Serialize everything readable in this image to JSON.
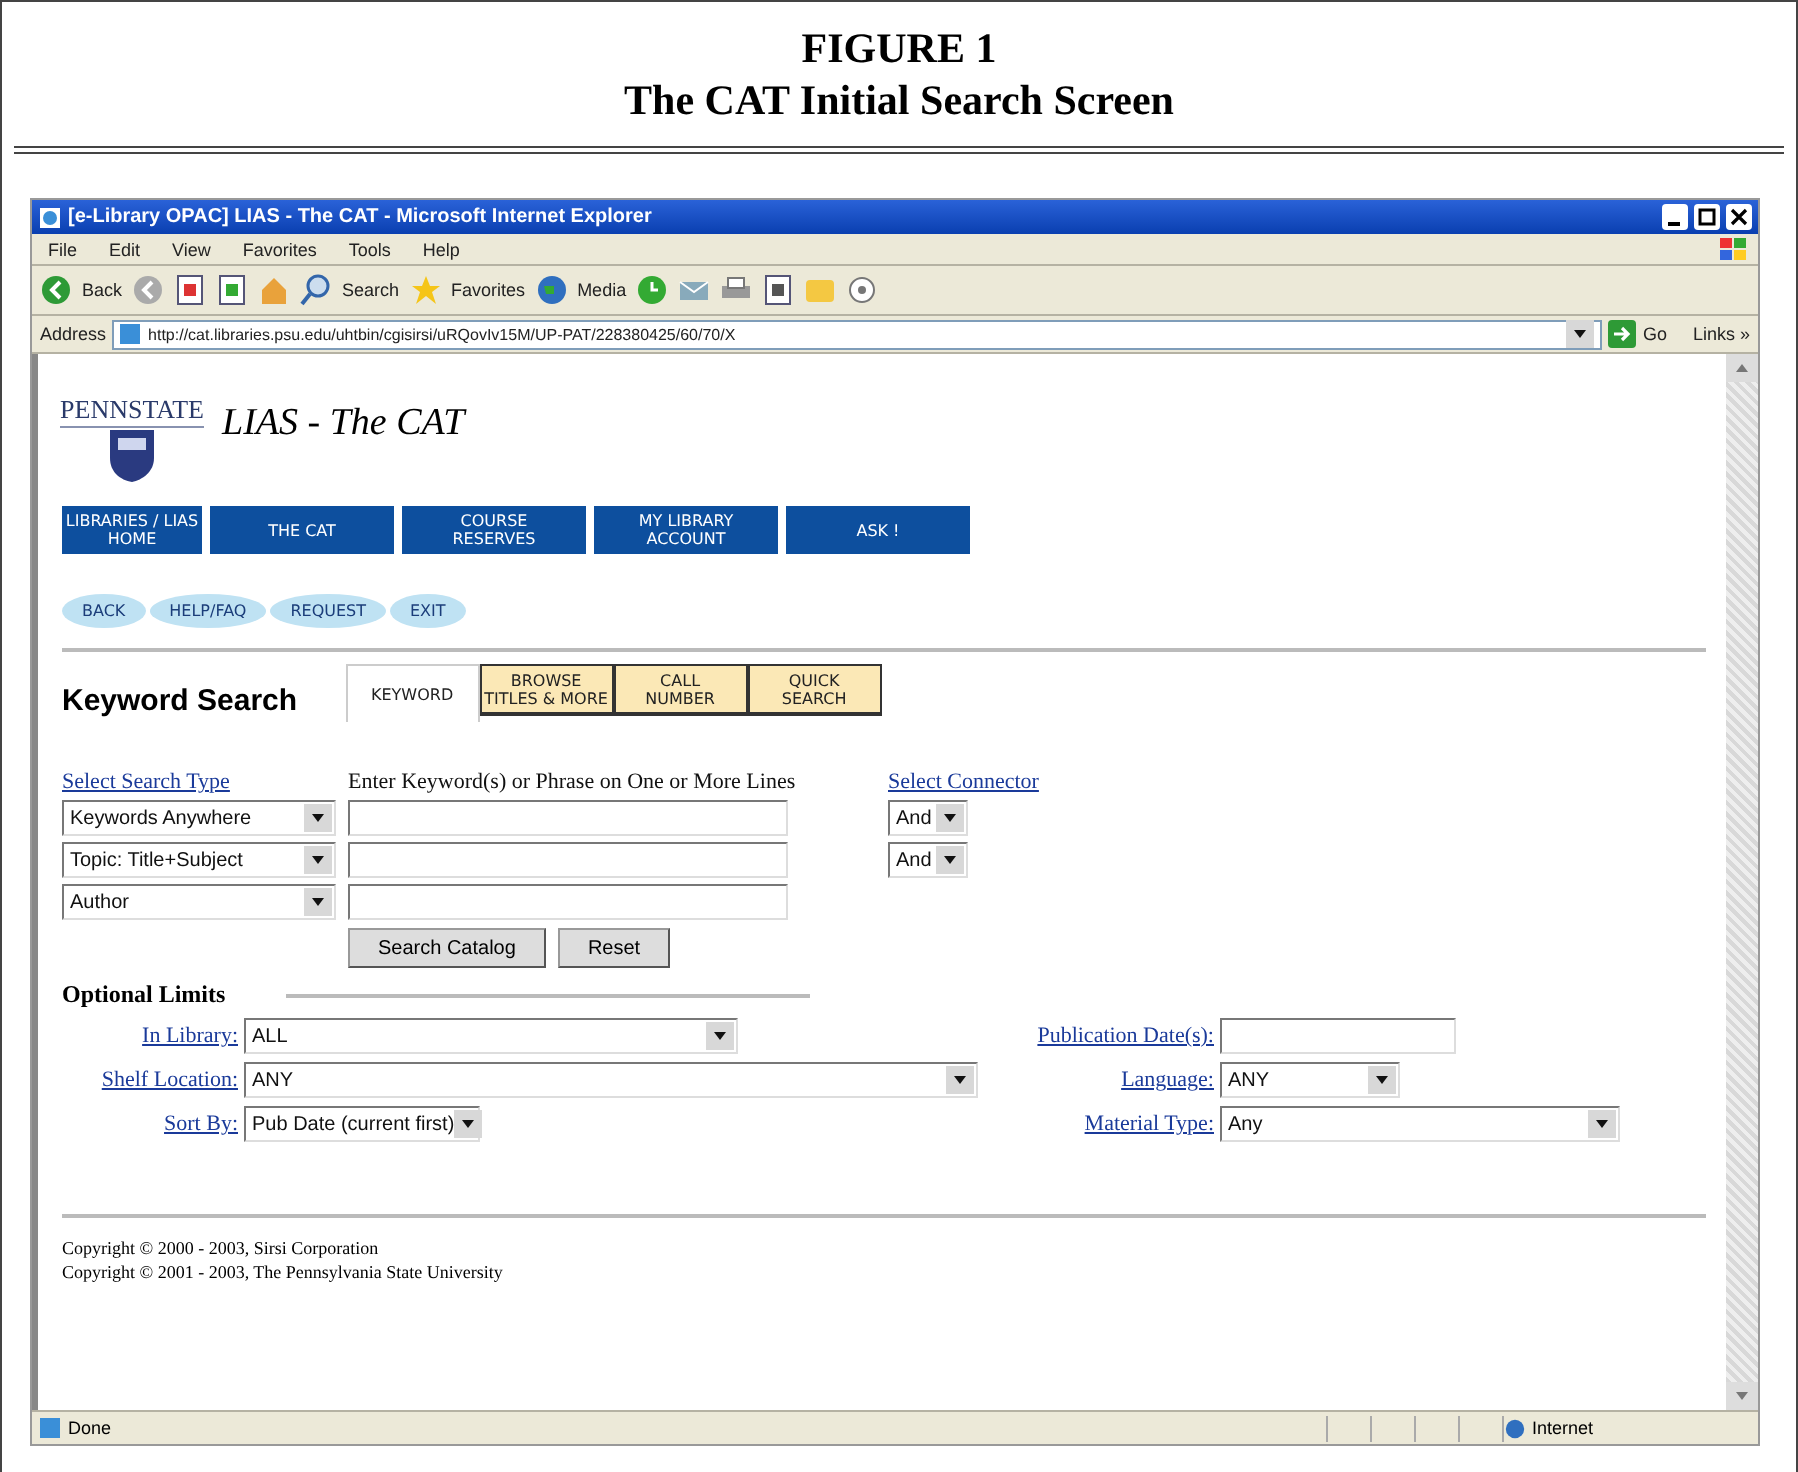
{
  "figure": {
    "label": "FIGURE 1",
    "caption": "The CAT Initial Search Screen"
  },
  "window": {
    "title": "[e-Library OPAC] LIAS - The CAT - Microsoft Internet Explorer"
  },
  "menu": [
    "File",
    "Edit",
    "View",
    "Favorites",
    "Tools",
    "Help"
  ],
  "toolbar": [
    "Back",
    "Search",
    "Favorites",
    "Media"
  ],
  "address": {
    "label": "Address",
    "url": "http://cat.libraries.psu.edu/uhtbin/cgisirsi/uRQovIv15M/UP-PAT/228380425/60/70/X",
    "go": "Go",
    "links": "Links »"
  },
  "page": {
    "logo": "PENNSTATE",
    "site_title": "LIAS - The CAT",
    "nav": [
      "LIBRARIES / LIAS\nHOME",
      "THE CAT",
      "COURSE\nRESERVES",
      "MY LIBRARY\nACCOUNT",
      "ASK !"
    ],
    "actions": [
      "BACK",
      "HELP/FAQ",
      "REQUEST",
      "EXIT"
    ],
    "heading": "Keyword Search",
    "tabs": [
      {
        "label": "KEYWORD",
        "selected": true
      },
      {
        "label": "BROWSE\nTITLES & MORE",
        "selected": false
      },
      {
        "label": "CALL\nNUMBER",
        "selected": false
      },
      {
        "label": "QUICK\nSEARCH",
        "selected": false
      }
    ],
    "select_type_link": "Select Search Type",
    "instructions": "Enter Keyword(s) or Phrase on One or More Lines",
    "connector_link": "Select Connector",
    "rows": [
      {
        "type": "Keywords Anywhere",
        "connector": "And"
      },
      {
        "type": "Topic: Title+Subject",
        "connector": "And"
      },
      {
        "type": "Author"
      }
    ],
    "buttons": [
      "Search Catalog",
      "Reset"
    ],
    "limits_heading": "Optional Limits",
    "limits": [
      {
        "label": "In Library:",
        "kind": "select",
        "value": "ALL"
      },
      {
        "label": "Publication Date(s):",
        "kind": "input"
      },
      {
        "label": "Shelf Location:",
        "kind": "select",
        "value": "ANY"
      },
      {
        "label": "Language:",
        "kind": "select",
        "value": "ANY"
      },
      {
        "label": "Sort By:",
        "kind": "select",
        "value": "Pub Date (current first)"
      },
      {
        "label": "Material Type:",
        "kind": "select",
        "value": "Any"
      }
    ],
    "copyright": [
      "Copyright © 2000 - 2003, Sirsi Corporation",
      "Copyright © 2001 - 2003, The Pennsylvania State University"
    ]
  },
  "status": {
    "text": "Done",
    "zone": "Internet"
  }
}
